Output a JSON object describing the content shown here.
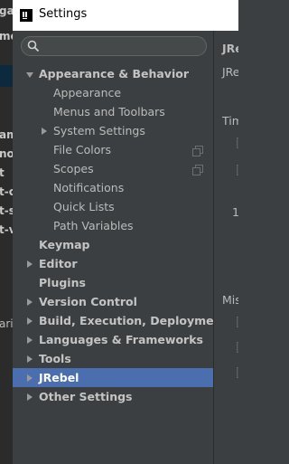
{
  "window": {
    "title": "Settings"
  },
  "background": {
    "fragments": [
      "ga",
      "me",
      "am",
      "no",
      "t",
      "t-c",
      "t-s",
      "t-v",
      "ari"
    ]
  },
  "search": {
    "placeholder": ""
  },
  "tree": {
    "appearance_behavior": "Appearance & Behavior",
    "appearance": "Appearance",
    "menus_toolbars": "Menus and Toolbars",
    "system_settings": "System Settings",
    "file_colors": "File Colors",
    "scopes": "Scopes",
    "notifications": "Notifications",
    "quick_lists": "Quick Lists",
    "path_variables": "Path Variables",
    "keymap": "Keymap",
    "editor": "Editor",
    "plugins": "Plugins",
    "version_control": "Version Control",
    "build_execution_deployment": "Build, Execution, Deployment",
    "languages_frameworks": "Languages & Frameworks",
    "tools": "Tools",
    "jrebel": "JRebel",
    "other_settings": "Other Settings"
  },
  "content": {
    "header": "JRe",
    "line1": "JRe",
    "timeouts": "Tim",
    "number": "1",
    "misc": "Mis"
  },
  "colors": {
    "selection": "#4b6eaf",
    "panel": "#3c3f41",
    "titlebar": "#ffffff"
  }
}
